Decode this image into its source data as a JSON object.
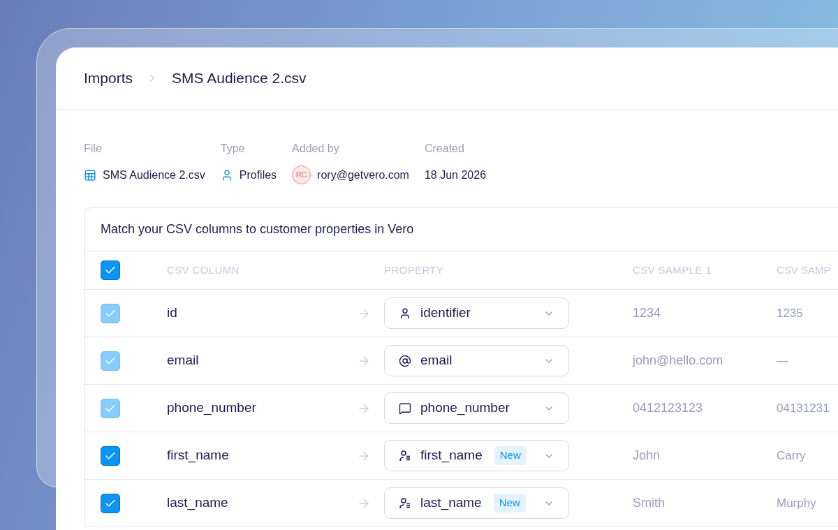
{
  "breadcrumb": [
    {
      "label": "Imports"
    },
    {
      "label": "SMS Audience 2.csv"
    }
  ],
  "meta": [
    {
      "label": "File",
      "value": "SMS Audience 2.csv",
      "kind": "file"
    },
    {
      "label": "Type",
      "value": "Profiles",
      "kind": "profile"
    },
    {
      "label": "Added by",
      "value": "rory@getvero.com",
      "kind": "avatar",
      "initials": "RC"
    },
    {
      "label": "Created",
      "value": "18 Jun 2026",
      "kind": "plain"
    }
  ],
  "table": {
    "title": "Match your CSV columns to customer properties in Vero",
    "header_checkbox": {
      "checked": true,
      "disabled": false
    },
    "columns": [
      "CSV COLUMN",
      "PROPERTY",
      "CSV SAMPLE 1",
      "CSV SAMP"
    ],
    "rows": [
      {
        "checked": true,
        "disabled": true,
        "column": "id",
        "property": "identifier",
        "kind": "user",
        "badge": null,
        "sample_1": "1234",
        "sample_2": "1235"
      },
      {
        "checked": true,
        "disabled": true,
        "column": "email",
        "property": "email",
        "kind": "at",
        "badge": null,
        "sample_1": "john@hello.com",
        "sample_2": "—"
      },
      {
        "checked": true,
        "disabled": true,
        "column": "phone_number",
        "property": "phone_number",
        "kind": "message",
        "badge": null,
        "sample_1": "0412123123",
        "sample_2": "04131231"
      },
      {
        "checked": true,
        "disabled": false,
        "column": "first_name",
        "property": "first_name",
        "kind": "user-list",
        "badge": "New",
        "sample_1": "John",
        "sample_2": "Carry"
      },
      {
        "checked": true,
        "disabled": false,
        "column": "last_name",
        "property": "last_name",
        "kind": "user-list",
        "badge": "New",
        "sample_1": "Smith",
        "sample_2": "Murphy"
      }
    ]
  }
}
